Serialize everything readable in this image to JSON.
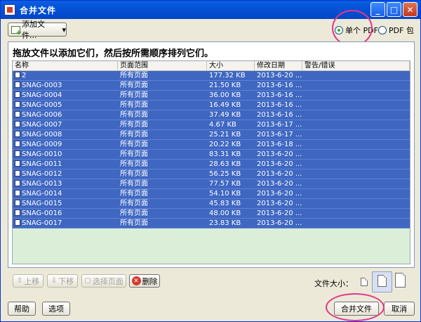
{
  "window": {
    "title": "合并文件"
  },
  "toolbar": {
    "add_label": "添加文件...",
    "add_arrow": "▾"
  },
  "output_mode": {
    "single_pdf": "单个 PDF",
    "pdf_package": "PDF 包",
    "selected": "single_pdf"
  },
  "panel": {
    "instruction": "拖放文件以添加它们，然后按所需顺序排列它们。"
  },
  "table": {
    "columns": [
      "名称",
      "页面范围",
      "大小",
      "修改日期",
      "警告/错误"
    ],
    "rows": [
      {
        "name": "2",
        "range": "所有页面",
        "size": "177.32 KB",
        "date": "2013-6-20 ..."
      },
      {
        "name": "SNAG-0003",
        "range": "所有页面",
        "size": "21.50 KB",
        "date": "2013-6-16 ..."
      },
      {
        "name": "SNAG-0004",
        "range": "所有页面",
        "size": "36.00 KB",
        "date": "2013-6-16 ..."
      },
      {
        "name": "SNAG-0005",
        "range": "所有页面",
        "size": "16.49 KB",
        "date": "2013-6-16 ..."
      },
      {
        "name": "SNAG-0006",
        "range": "所有页面",
        "size": "37.49 KB",
        "date": "2013-6-16 ..."
      },
      {
        "name": "SNAG-0007",
        "range": "所有页面",
        "size": "4.67 KB",
        "date": "2013-6-17 ..."
      },
      {
        "name": "SNAG-0008",
        "range": "所有页面",
        "size": "25.21 KB",
        "date": "2013-6-17 ..."
      },
      {
        "name": "SNAG-0009",
        "range": "所有页面",
        "size": "20.22 KB",
        "date": "2013-6-18 ..."
      },
      {
        "name": "SNAG-0010",
        "range": "所有页面",
        "size": "83.31 KB",
        "date": "2013-6-20 ..."
      },
      {
        "name": "SNAG-0011",
        "range": "所有页面",
        "size": "28.63 KB",
        "date": "2013-6-20 ..."
      },
      {
        "name": "SNAG-0012",
        "range": "所有页面",
        "size": "56.25 KB",
        "date": "2013-6-20 ..."
      },
      {
        "name": "SNAG-0013",
        "range": "所有页面",
        "size": "77.57 KB",
        "date": "2013-6-20 ..."
      },
      {
        "name": "SNAG-0014",
        "range": "所有页面",
        "size": "54.10 KB",
        "date": "2013-6-20 ..."
      },
      {
        "name": "SNAG-0015",
        "range": "所有页面",
        "size": "45.83 KB",
        "date": "2013-6-20 ..."
      },
      {
        "name": "SNAG-0016",
        "range": "所有页面",
        "size": "48.00 KB",
        "date": "2013-6-20 ..."
      },
      {
        "name": "SNAG-0017",
        "range": "所有页面",
        "size": "23.83 KB",
        "date": "2013-6-20 ..."
      }
    ]
  },
  "list_buttons": {
    "move_up": "上移",
    "move_down": "下移",
    "select_pages": "选择页面",
    "delete": "删除"
  },
  "file_size": {
    "label": "文件大小："
  },
  "footer": {
    "help": "帮助",
    "options": "选项",
    "merge": "合并文件",
    "cancel": "取消"
  },
  "colors": {
    "title_blue": "#0453d8",
    "row_selected": "#3f67c2",
    "list_bg": "#dbeed7",
    "highlight": "#e2368c"
  }
}
